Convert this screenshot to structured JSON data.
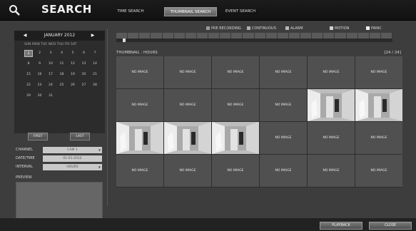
{
  "header": {
    "title": "SEARCH",
    "tabs": [
      {
        "label": "TIME SEARCH",
        "active": false
      },
      {
        "label": "THUMBNAIL SEARCH",
        "active": true
      },
      {
        "label": "EVENT SEARCH",
        "active": false
      }
    ]
  },
  "calendar": {
    "month_label": "JANUARY 2012",
    "weekdays": "SUN MON TUE WED THU FRI SAT",
    "days": [
      1,
      2,
      3,
      4,
      5,
      6,
      7,
      8,
      9,
      10,
      11,
      12,
      13,
      14,
      15,
      16,
      17,
      18,
      19,
      20,
      21,
      22,
      23,
      24,
      25,
      26,
      27,
      28,
      29,
      30,
      31
    ],
    "first_weekday_index": 0,
    "selected_day": 1,
    "first_label": "FIRST",
    "last_label": "LAST"
  },
  "fields": {
    "channel_label": "CHANNEL",
    "channel_value": "CAM 1",
    "date_label": "DATE/TIME",
    "date_value": "01-01-2012",
    "interval_label": "INTERVAL",
    "interval_value": "HOURS"
  },
  "preview_label": "PREVIEW",
  "legend": [
    {
      "label": "PRE RECORDING",
      "color": "#9a9a9a"
    },
    {
      "label": "CONTINUOUS",
      "color": "#b0b0b0"
    },
    {
      "label": "ALARM",
      "color": "#b8b8b8"
    },
    {
      "label": "MOTION",
      "color": "#d0d0d0"
    },
    {
      "label": "PANIC",
      "color": "#f0f0f0"
    }
  ],
  "thumbnail": {
    "label": "THUMBNAIL : HOURS",
    "count": "[24 / 24]",
    "no_image_text": "NO IMAGE",
    "cells": [
      {
        "has_image": false
      },
      {
        "has_image": false
      },
      {
        "has_image": false
      },
      {
        "has_image": false
      },
      {
        "has_image": false
      },
      {
        "has_image": false
      },
      {
        "has_image": false
      },
      {
        "has_image": false
      },
      {
        "has_image": false
      },
      {
        "has_image": false
      },
      {
        "has_image": true
      },
      {
        "has_image": true
      },
      {
        "has_image": true
      },
      {
        "has_image": true
      },
      {
        "has_image": true
      },
      {
        "has_image": false
      },
      {
        "has_image": false
      },
      {
        "has_image": false
      },
      {
        "has_image": false
      },
      {
        "has_image": false
      },
      {
        "has_image": false
      },
      {
        "has_image": false
      },
      {
        "has_image": false
      },
      {
        "has_image": false
      }
    ]
  },
  "footer": {
    "playback_label": "PLAYBACK",
    "close_label": "CLOSE"
  },
  "colors": {
    "background": "#3d3d3d",
    "topbar": "#151515",
    "thumb_cell": "#505050"
  }
}
